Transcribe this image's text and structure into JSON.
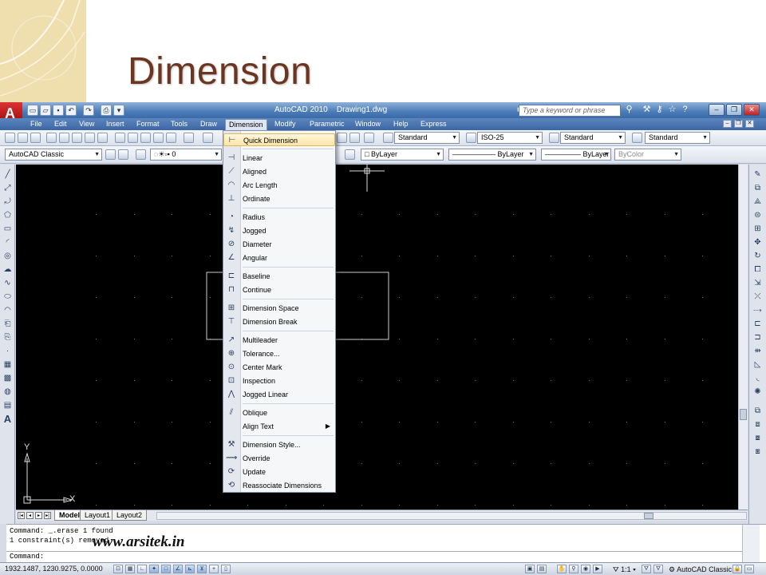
{
  "slide": {
    "title": "Dimension"
  },
  "window": {
    "title": "AutoCAD 2010",
    "document": "Drawing1.dwg",
    "search_placeholder": "Type a keyword or phrase"
  },
  "menubar": [
    "File",
    "Edit",
    "View",
    "Insert",
    "Format",
    "Tools",
    "Draw",
    "Dimension",
    "Modify",
    "Parametric",
    "Window",
    "Help",
    "Express"
  ],
  "toolbar": {
    "text_style": "Standard",
    "dim_style": "ISO-25",
    "table_style": "Standard",
    "mleader_style": "Standard",
    "workspace": "AutoCAD Classic",
    "layer": "0",
    "color": "ByLayer",
    "linetype": "ByLayer",
    "lineweight": "ByLayer",
    "plotstyle": "ByColor"
  },
  "dimension_menu": {
    "items": [
      {
        "label": "Quick Dimension",
        "icon": "quick-dimension-icon"
      },
      {
        "label": "Linear",
        "icon": "linear-icon"
      },
      {
        "label": "Aligned",
        "icon": "aligned-icon"
      },
      {
        "label": "Arc Length",
        "icon": "arc-length-icon"
      },
      {
        "label": "Ordinate",
        "icon": "ordinate-icon"
      },
      {
        "label": "Radius",
        "icon": "radius-icon"
      },
      {
        "label": "Jogged",
        "icon": "jogged-icon"
      },
      {
        "label": "Diameter",
        "icon": "diameter-icon"
      },
      {
        "label": "Angular",
        "icon": "angular-icon"
      },
      {
        "label": "Baseline",
        "icon": "baseline-icon"
      },
      {
        "label": "Continue",
        "icon": "continue-icon"
      },
      {
        "label": "Dimension Space",
        "icon": "dimension-space-icon"
      },
      {
        "label": "Dimension Break",
        "icon": "dimension-break-icon"
      },
      {
        "label": "Multileader",
        "icon": "multileader-icon"
      },
      {
        "label": "Tolerance...",
        "icon": "tolerance-icon"
      },
      {
        "label": "Center Mark",
        "icon": "center-mark-icon"
      },
      {
        "label": "Inspection",
        "icon": "inspection-icon"
      },
      {
        "label": "Jogged Linear",
        "icon": "jogged-linear-icon"
      },
      {
        "label": "Oblique",
        "icon": "oblique-icon"
      },
      {
        "label": "Align Text",
        "icon": ""
      },
      {
        "label": "Dimension Style...",
        "icon": "dimension-style-icon"
      },
      {
        "label": "Override",
        "icon": "override-icon"
      },
      {
        "label": "Update",
        "icon": "update-icon"
      },
      {
        "label": "Reassociate Dimensions",
        "icon": "reassociate-icon"
      }
    ]
  },
  "ucs": {
    "x": "X",
    "y": "Y"
  },
  "layout_tabs": [
    "Model",
    "Layout1",
    "Layout2"
  ],
  "command": {
    "history": [
      "Command: _.erase 1 found",
      "1 constraint(s) removed"
    ],
    "prompt": "Command:"
  },
  "watermark": "www.arsitek.in",
  "status": {
    "coords": "1932.1487, 1230.9275, 0.0000",
    "scale": "1:1",
    "workspace": "AutoCAD Classic"
  }
}
